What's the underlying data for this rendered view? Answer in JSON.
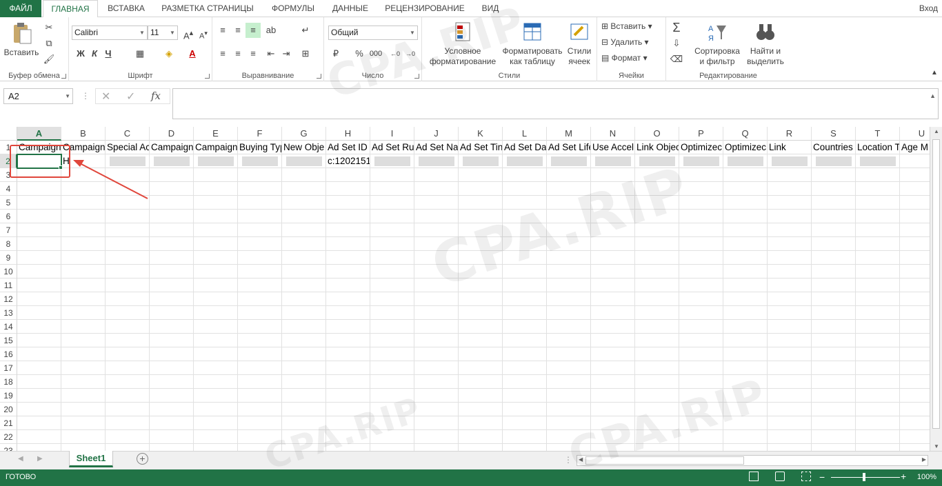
{
  "tabs": {
    "file": "ФАЙЛ",
    "home": "ГЛАВНАЯ",
    "insert": "ВСТАВКА",
    "page_layout": "РАЗМЕТКА СТРАНИЦЫ",
    "formulas": "ФОРМУЛЫ",
    "data": "ДАННЫЕ",
    "review": "РЕЦЕНЗИРОВАНИЕ",
    "view": "ВИД",
    "sign_in": "Вход"
  },
  "ribbon": {
    "clipboard": {
      "label": "Буфер обмена",
      "paste": "Вставить"
    },
    "font": {
      "label": "Шрифт",
      "font_name": "Calibri",
      "font_size": "11",
      "bold": "Ж",
      "italic": "К",
      "underline": "Ч"
    },
    "alignment": {
      "label": "Выравнивание"
    },
    "number": {
      "label": "Число",
      "format": "Общий",
      "percent": "%",
      "thousands": "000"
    },
    "styles": {
      "label": "Стили",
      "conditional_1": "Условное",
      "conditional_2": "форматирование",
      "format_table_1": "Форматировать",
      "format_table_2": "как таблицу",
      "cell_styles_1": "Стили",
      "cell_styles_2": "ячеек"
    },
    "cells": {
      "label": "Ячейки",
      "insert": "Вставить",
      "delete": "Удалить",
      "format": "Формат"
    },
    "editing": {
      "label": "Редактирование",
      "sort_1": "Сортировка",
      "sort_2": "и фильтр",
      "find_1": "Найти и",
      "find_2": "выделить"
    }
  },
  "formula_bar": {
    "name_box": "A2",
    "fx": "fx",
    "value": ""
  },
  "columns": [
    "A",
    "B",
    "C",
    "D",
    "E",
    "F",
    "G",
    "H",
    "I",
    "J",
    "K",
    "L",
    "M",
    "N",
    "O",
    "P",
    "Q",
    "R",
    "S",
    "T",
    "U"
  ],
  "rows": [
    "1",
    "2",
    "3",
    "4",
    "5",
    "6",
    "7",
    "8",
    "9",
    "10",
    "11",
    "12",
    "13",
    "14",
    "15",
    "16",
    "17",
    "18",
    "19",
    "20",
    "21",
    "22",
    "23"
  ],
  "row1": [
    "Campaign",
    "Campaign",
    "Special Ac",
    "Campaign",
    "Campaign",
    "Buying Typ",
    "New Obje",
    "Ad Set ID",
    "Ad Set Ru",
    "Ad Set Na",
    "Ad Set Tin",
    "Ad Set Da",
    "Ad Set Life",
    "Use Accel",
    "Link Objec",
    "Optimizec",
    "Optimizec",
    "Link",
    "Countries",
    "Location T",
    "Age M"
  ],
  "row2": {
    "B": "H",
    "H": "c:1202151:"
  },
  "sheet": {
    "name": "Sheet1"
  },
  "status": {
    "ready": "ГОТОВО",
    "zoom": "100%"
  },
  "watermark": "CPA.RIP",
  "colors": {
    "accent": "#217346",
    "annotation": "#e0463b"
  }
}
